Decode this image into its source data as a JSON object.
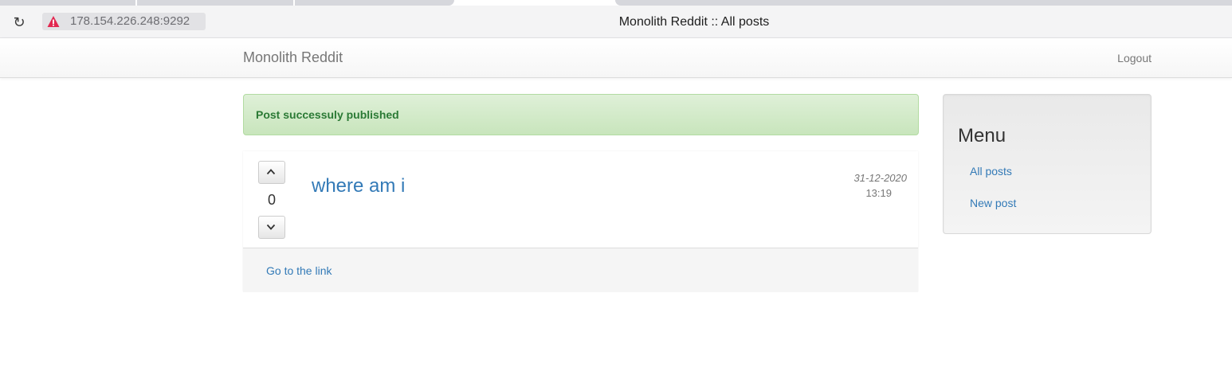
{
  "browser": {
    "url": "178.154.226.248:9292",
    "tab_title": "Monolith Reddit :: All posts",
    "reload_icon": "reload-icon",
    "security_icon": "warning-triangle-icon",
    "security_color": "#e22850"
  },
  "navbar": {
    "brand": "Monolith Reddit",
    "logout": "Logout"
  },
  "alert": {
    "message": "Post successuly published",
    "color": "#3c763d"
  },
  "post": {
    "score": "0",
    "title": "where am i",
    "date": "31-12-2020",
    "time": "13:19",
    "link": "Go to the link",
    "upvote_icon": "chevron-up-icon",
    "downvote_icon": "chevron-down-icon"
  },
  "sidebar": {
    "heading": "Menu",
    "items": [
      {
        "label": "All posts"
      },
      {
        "label": "New post"
      }
    ]
  },
  "colors": {
    "link": "#337ab7",
    "muted": "#777777"
  }
}
